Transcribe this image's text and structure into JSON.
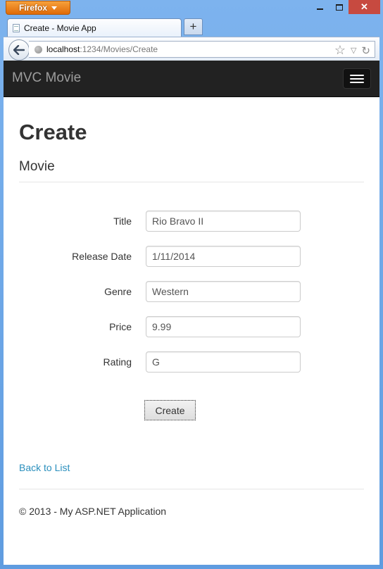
{
  "browser": {
    "menu_label": "Firefox",
    "tab_title": "Create - Movie App",
    "newtab_label": "+",
    "close_label": "✕",
    "url_host": "localhost",
    "url_path": ":1234/Movies/Create",
    "star_icon": "☆",
    "dropdown_icon": "▽",
    "reload_icon": "↻"
  },
  "navbar": {
    "brand": "MVC Movie"
  },
  "page": {
    "heading": "Create",
    "subheading": "Movie"
  },
  "form": {
    "fields": [
      {
        "label": "Title",
        "value": "Rio Bravo II"
      },
      {
        "label": "Release Date",
        "value": "1/11/2014"
      },
      {
        "label": "Genre",
        "value": "Western"
      },
      {
        "label": "Price",
        "value": "9.99"
      },
      {
        "label": "Rating",
        "value": "G"
      }
    ],
    "submit_label": "Create"
  },
  "links": {
    "back_to_list": "Back to List"
  },
  "footer": {
    "text": "© 2013 - My ASP.NET Application"
  },
  "colors": {
    "navbar_bg": "#222222",
    "link": "#2a8fbd",
    "window_chrome": "#6fa4e0",
    "firefox_button": "#e47a12",
    "close_button": "#c74a40"
  }
}
